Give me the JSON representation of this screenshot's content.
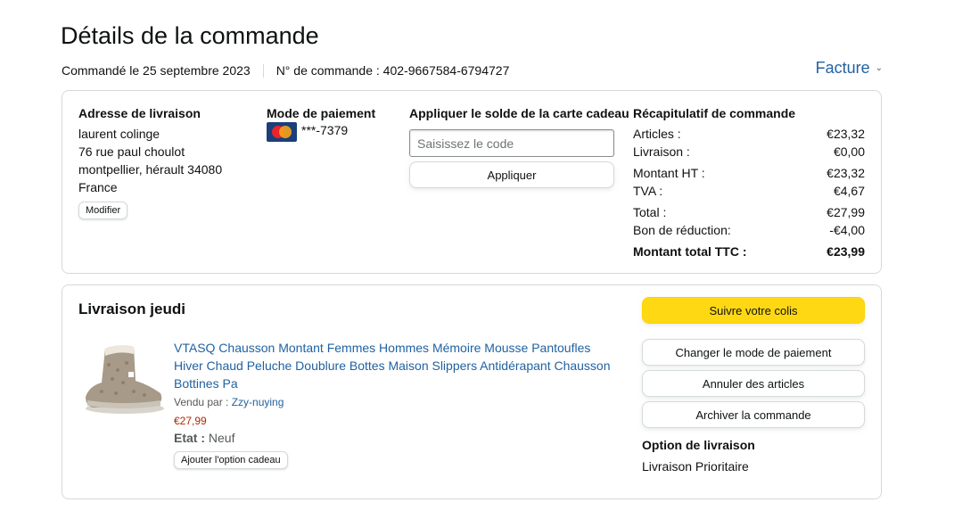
{
  "header": {
    "title": "Détails de la commande",
    "ordered_on": "Commandé le 25 septembre 2023",
    "order_number": "N° de commande : 402-9667584-6794727",
    "invoice_label": "Facture"
  },
  "shipping": {
    "title": "Adresse de livraison",
    "name": "laurent colinge",
    "street": "76 rue paul choulot",
    "city": "montpellier, hérault 34080",
    "country": "France",
    "edit_label": "Modifier"
  },
  "payment": {
    "title": "Mode de paiement",
    "card_icon": "mastercard-icon",
    "card_number": "***-7379"
  },
  "gift_card": {
    "title": "Appliquer le solde de la carte cadeau",
    "placeholder": "Saisissez le code",
    "apply_label": "Appliquer"
  },
  "summary": {
    "title": "Récapitulatif de commande",
    "rows": [
      {
        "label": "Articles :",
        "value": "€23,32"
      },
      {
        "label": "Livraison :",
        "value": "€0,00"
      },
      {
        "label": "Montant HT :",
        "value": "€23,32"
      },
      {
        "label": "TVA :",
        "value": "€4,67"
      },
      {
        "label": "Total :",
        "value": "€27,99"
      },
      {
        "label": "Bon de réduction:",
        "value": "-€4,00"
      }
    ],
    "grand_total_label": "Montant total TTC :",
    "grand_total_value": "€23,99"
  },
  "delivery": {
    "title": "Livraison jeudi",
    "product": {
      "name": "VTASQ Chausson Montant Femmes Hommes Mémoire Mousse Pantoufles Hiver Chaud Peluche Doublure Bottes Maison Slippers Antidérapant Chausson Bottines Pa",
      "sold_by_label": "Vendu par : ",
      "seller": "Zzy-nuying",
      "price": "€27,99",
      "state_label": "Etat : ",
      "state_value": "Neuf",
      "gift_label": "Ajouter l'option cadeau"
    },
    "actions": {
      "track": "Suivre votre colis",
      "change_payment": "Changer le mode de paiement",
      "cancel": "Annuler des articles",
      "archive": "Archiver la commande"
    },
    "option_title": "Option de livraison",
    "option_value": "Livraison Prioritaire"
  },
  "colors": {
    "link": "#2162a1",
    "primary_button": "#ffd814",
    "price": "#b12704"
  }
}
